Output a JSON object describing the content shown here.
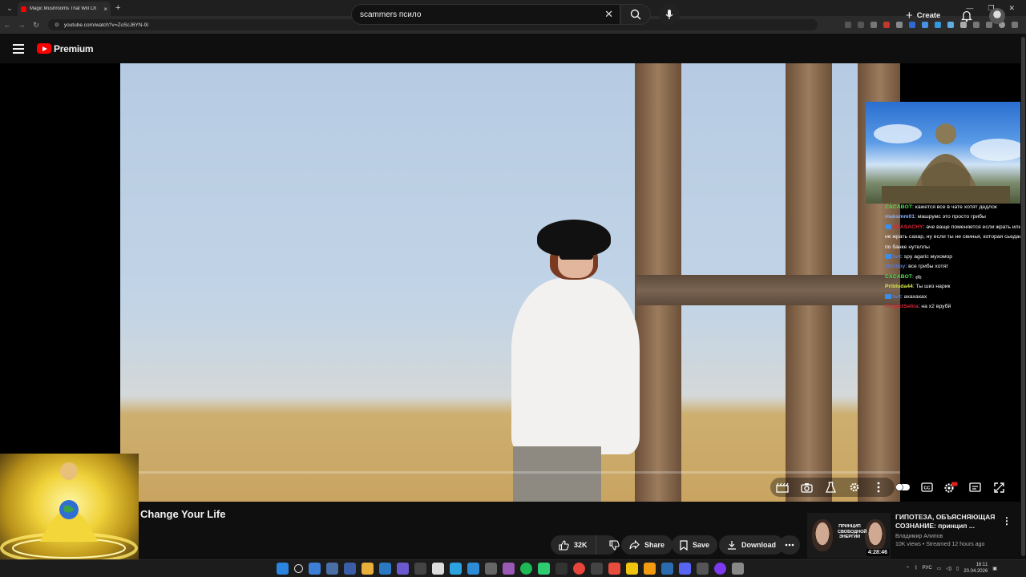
{
  "browser": {
    "tab_title": "Magic Mushrooms That Will Ch",
    "url": "youtube.com/watch?v=ZoScJ6YN-9I",
    "new_tab": "+",
    "tab_close": "×",
    "win_min": "—",
    "win_max": "❐",
    "win_close": "✕"
  },
  "header": {
    "logo_text": "Premium",
    "search_value": "scammers псило",
    "create_label": "Create"
  },
  "video": {
    "title": "Change Your Life"
  },
  "actions": {
    "like_count": "32K",
    "share_label": "Share",
    "save_label": "Save",
    "download_label": "Download"
  },
  "chat": [
    {
      "user": "CACABOT",
      "user_color": "#4ee04e",
      "message": "кажется все в чате хотят дедлок",
      "badge": false
    },
    {
      "user": "maksmm01",
      "user_color": "#8ab4ff",
      "message": "машрумс это просто грибы",
      "badge": false
    },
    {
      "user": "ADASACHY",
      "user_color": "#e0243a",
      "message": "аче ваще поменяется если жрать или не жрать сахар, ну если ты не свинья, которая сьедает по банке нутеллы",
      "badge": true
    },
    {
      "user": "fart",
      "user_color": "#5a7bd6",
      "message": "spy agaric мухомор",
      "badge": true
    },
    {
      "user": "shizboy",
      "user_color": "#5a7bd6",
      "message": "все грибы хотят",
      "badge": false
    },
    {
      "user": "CACABOT",
      "user_color": "#4ee04e",
      "message": "🚓",
      "badge": false
    },
    {
      "user": "Pribluda44",
      "user_color": "#d6e64c",
      "message": "Ты шиз нарик",
      "badge": false
    },
    {
      "user": "fart",
      "user_color": "#5a7bd6",
      "message": "ахахахах",
      "badge": true
    },
    {
      "user": "ProjectSelira",
      "user_color": "#e0243a",
      "message": "на х2 врубй",
      "badge": false
    }
  ],
  "recommendation": {
    "thumb_text": "ПРИНЦИП СВОБОДНОЙ ЭНЕРГИИ",
    "duration": "4:28:46",
    "title": "ГИПОТЕЗА, ОБЪЯСНЯЮЩАЯ СОЗНАНИЕ: принцип ...",
    "channel": "Владимир Алипов",
    "meta": "10K views • Streamed 12 hours ago"
  },
  "taskbar": {
    "lang": "РУС",
    "time": "16:11",
    "date": "20.04.2026"
  },
  "colors": {
    "yt_red": "#ff0000",
    "bg": "#0f0f0f",
    "pill": "#272727"
  }
}
